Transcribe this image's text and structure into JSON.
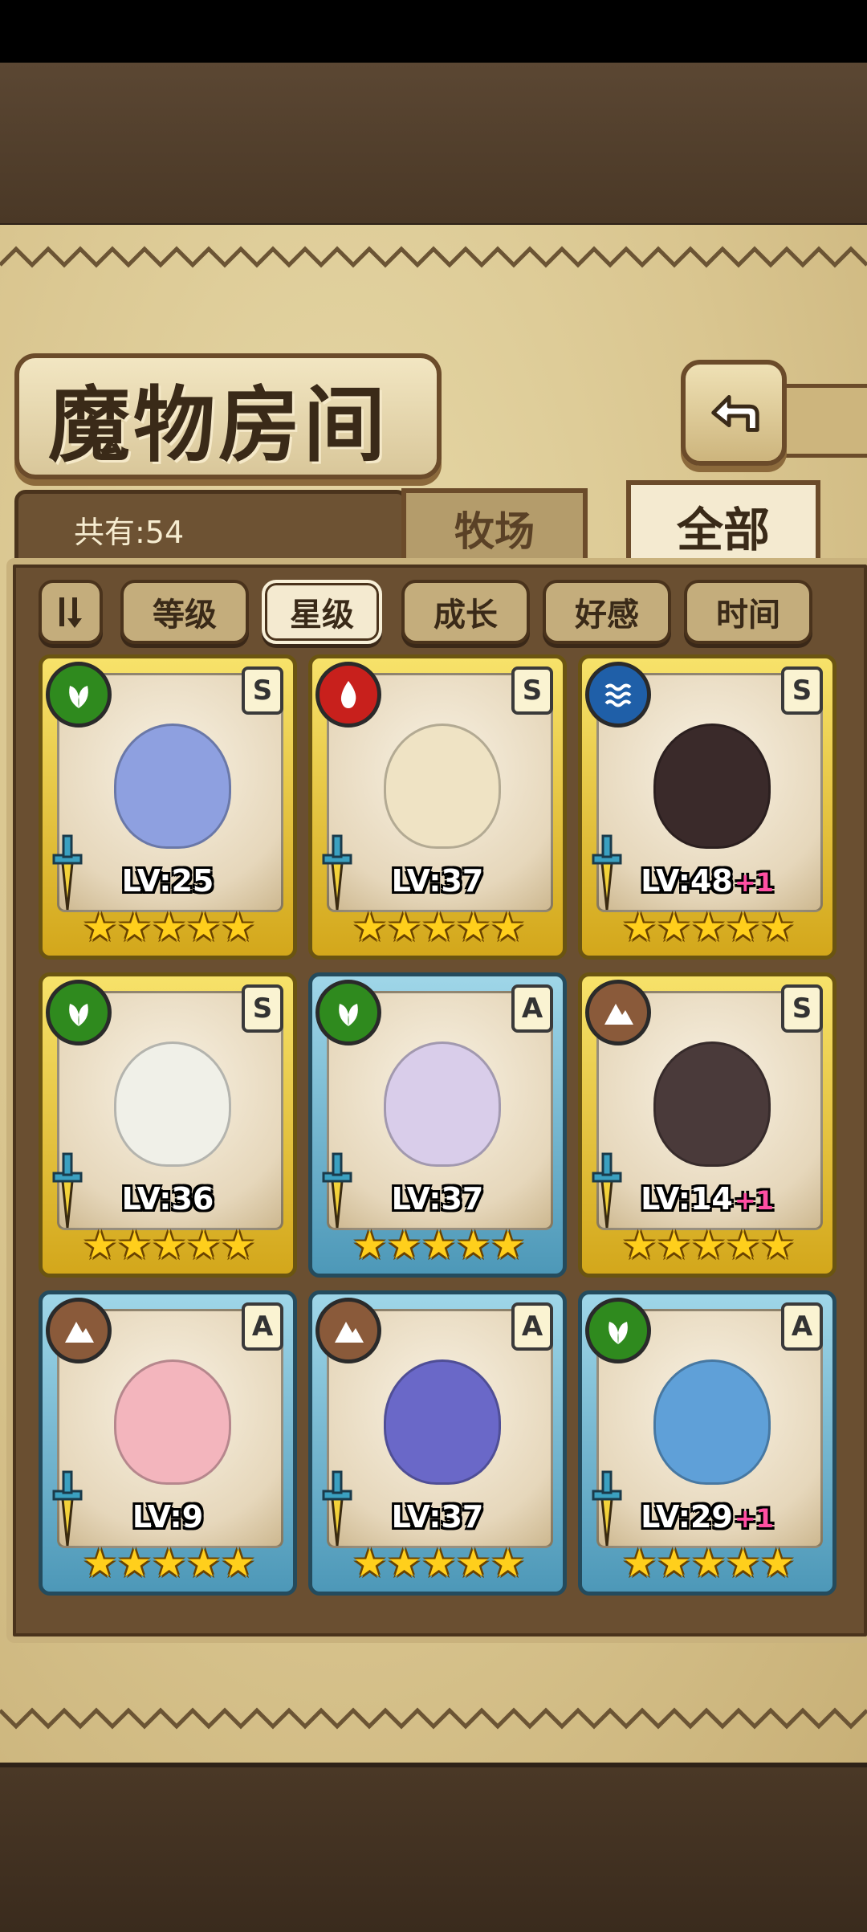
{
  "header": {
    "title": "魔物房间"
  },
  "summary": {
    "count_label": "共有:54"
  },
  "tabs": [
    {
      "label": "牧场",
      "active": false
    },
    {
      "label": "全部",
      "active": true
    }
  ],
  "filters": [
    {
      "label": "等级",
      "active": false
    },
    {
      "label": "星级",
      "active": true
    },
    {
      "label": "成长",
      "active": false
    },
    {
      "label": "好感",
      "active": false
    },
    {
      "label": "时间",
      "active": false
    }
  ],
  "monsters": [
    {
      "element": "nature",
      "rank": "S",
      "level": "LV:25",
      "bonus": "",
      "stars": 5,
      "frame": "gold"
    },
    {
      "element": "fire",
      "rank": "S",
      "level": "LV:37",
      "bonus": "",
      "stars": 5,
      "frame": "gold"
    },
    {
      "element": "water",
      "rank": "S",
      "level": "LV:48",
      "bonus": "+1",
      "stars": 5,
      "frame": "gold"
    },
    {
      "element": "nature",
      "rank": "S",
      "level": "LV:36",
      "bonus": "",
      "stars": 5,
      "frame": "gold"
    },
    {
      "element": "nature",
      "rank": "A",
      "level": "LV:37",
      "bonus": "",
      "stars": 5,
      "frame": "blue"
    },
    {
      "element": "earth",
      "rank": "S",
      "level": "LV:14",
      "bonus": "+1",
      "stars": 5,
      "frame": "gold"
    },
    {
      "element": "earth",
      "rank": "A",
      "level": "LV:9",
      "bonus": "",
      "stars": 5,
      "frame": "blue"
    },
    {
      "element": "earth",
      "rank": "A",
      "level": "LV:37",
      "bonus": "",
      "stars": 5,
      "frame": "blue"
    },
    {
      "element": "nature",
      "rank": "A",
      "level": "LV:29",
      "bonus": "+1",
      "stars": 5,
      "frame": "blue"
    }
  ],
  "colors": {
    "nature": "#2f8a1e",
    "fire": "#c8201c",
    "water": "#1f5fa8",
    "earth": "#8a5a3a",
    "star": "#ffcf1c",
    "bonus": "#ff4fa3"
  }
}
